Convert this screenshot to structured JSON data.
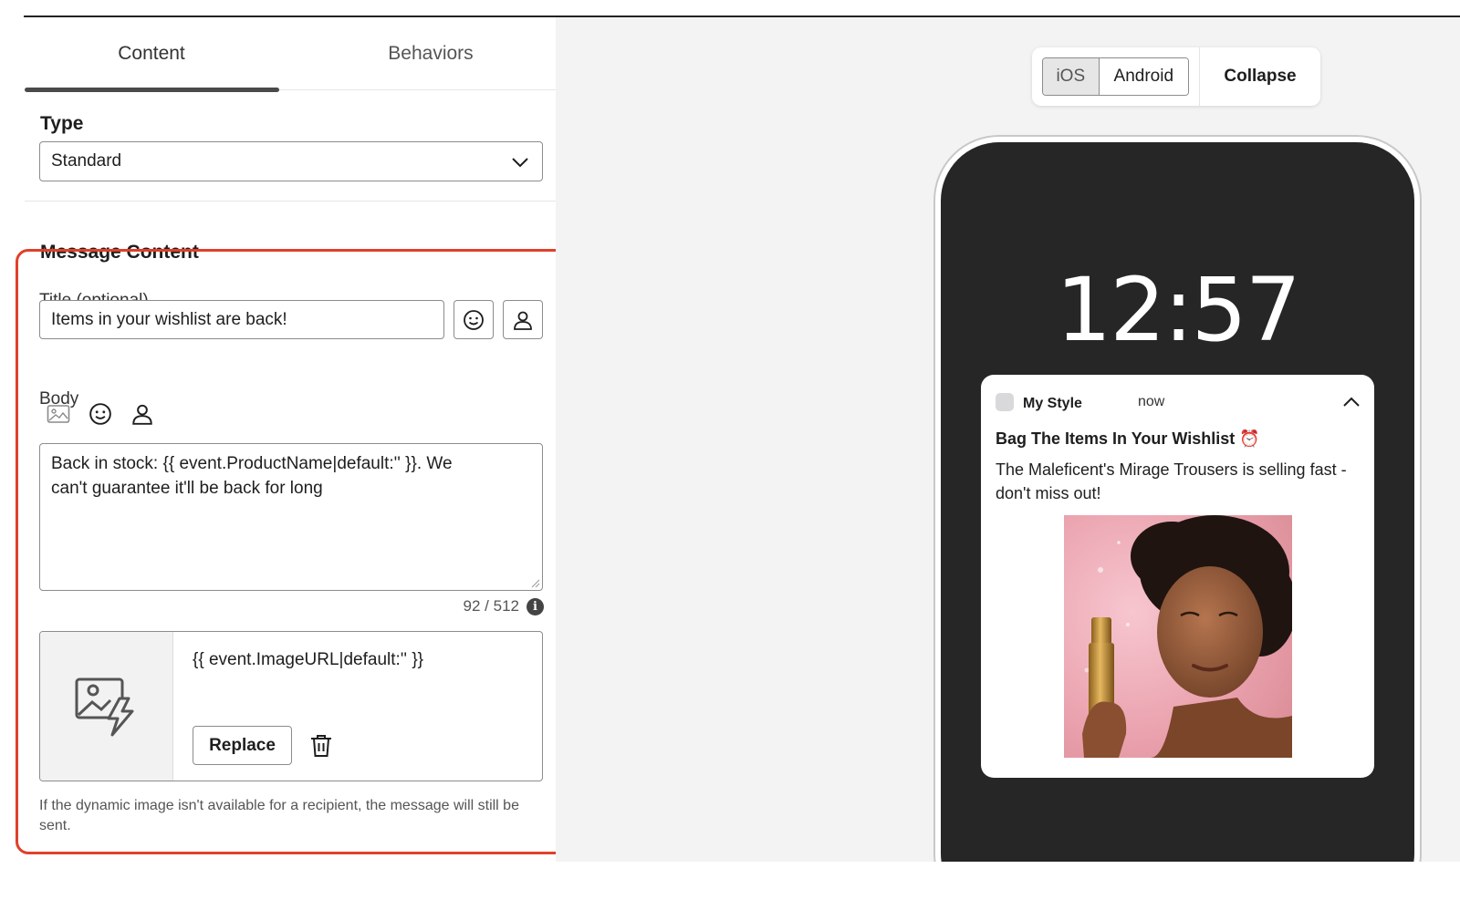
{
  "tabs": [
    {
      "label": "Content",
      "active": true
    },
    {
      "label": "Behaviors",
      "active": false
    }
  ],
  "type_section": {
    "title": "Type",
    "selected": "Standard"
  },
  "message_content": {
    "title": "Message Content",
    "title_field": {
      "label": "Title (optional)",
      "value": "Items in your wishlist are back!"
    },
    "body_field": {
      "label": "Body",
      "line1": "Back in stock: {{ event.ProductName|default:'' }}. We",
      "line2": "can't guarantee it'll be back for long",
      "counter": "92 / 512"
    },
    "image": {
      "url": "{{ event.ImageURL|default:'' }}",
      "replace_label": "Replace"
    },
    "helper_text": "If the dynamic image isn't available for a recipient, the message will still be sent."
  },
  "preview": {
    "platforms": [
      "iOS",
      "Android"
    ],
    "selected_platform": "iOS",
    "collapse_label": "Collapse",
    "clock": "12:57",
    "notification": {
      "app_name": "My Style",
      "time": "now",
      "title": "Bag The Items In Your Wishlist ⏰",
      "body": "The Maleficent's Mirage Trousers is selling fast - don't miss out!"
    }
  },
  "colors": {
    "highlight": "#e0402a",
    "phone_screen": "#262627",
    "preview_bg": "#f3f3f4"
  },
  "icons": [
    "chevron-down-icon",
    "emoji-icon",
    "person-icon",
    "image-icon",
    "info-icon",
    "dynamic-image-icon",
    "trash-icon",
    "chevron-up-icon"
  ]
}
